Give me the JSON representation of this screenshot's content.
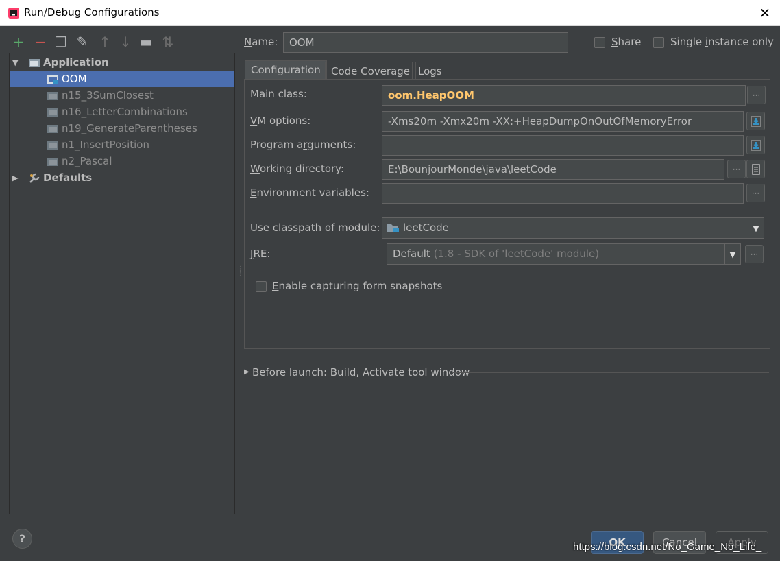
{
  "window": {
    "title": "Run/Debug Configurations"
  },
  "toolbar": [
    {
      "name": "add-icon",
      "glyph": "+",
      "color": "#59a869"
    },
    {
      "name": "remove-icon",
      "glyph": "−",
      "color": "#c75450"
    },
    {
      "name": "copy-icon",
      "glyph": "❐",
      "color": "#afb1b3"
    },
    {
      "name": "wrench-icon",
      "glyph": "✎",
      "color": "#afb1b3"
    },
    {
      "name": "arrow-up-icon",
      "glyph": "↑",
      "color": "#6e6e6e"
    },
    {
      "name": "arrow-down-icon",
      "glyph": "↓",
      "color": "#6e6e6e"
    },
    {
      "name": "folder-icon",
      "glyph": "▬",
      "color": "#afb1b3"
    },
    {
      "name": "sort-icon",
      "glyph": "⇅",
      "color": "#6e6e6e"
    }
  ],
  "tree": {
    "application": "Application",
    "items": [
      "OOM",
      "n15_3SumClosest",
      "n16_LetterCombinations",
      "n19_GenerateParentheses",
      "n1_InsertPosition",
      "n2_Pascal"
    ],
    "defaults": "Defaults"
  },
  "name": {
    "label_u": "N",
    "label_rest": "ame:",
    "value": "OOM"
  },
  "share": {
    "label_u": "S",
    "label_rest": "hare"
  },
  "single": {
    "label_pre": "Single ",
    "label_u": "i",
    "label_rest": "nstance only"
  },
  "tabs": [
    "Configuration",
    "Code Coverage",
    "Logs"
  ],
  "form": {
    "main_class_label": "Main class:",
    "main_class_value": "oom.HeapOOM",
    "vm_label_u": "V",
    "vm_label_rest": "M options:",
    "vm_value": "-Xms20m -Xmx20m -XX:+HeapDumpOnOutOfMemoryError",
    "prog_label_pre": "Program a",
    "prog_label_u": "r",
    "prog_label_rest": "guments:",
    "prog_value": "",
    "wd_label_u": "W",
    "wd_label_rest": "orking directory:",
    "wd_value": "E:\\BounjourMonde\\java\\leetCode",
    "env_label_u": "E",
    "env_label_rest": "nvironment variables:",
    "env_value": "",
    "cp_label_pre": "Use classpath of mo",
    "cp_label_u": "d",
    "cp_label_rest": "ule:",
    "cp_value": "leetCode",
    "jre_label_u": "J",
    "jre_label_rest": "RE:",
    "jre_value": "Default",
    "jre_detail": "(1.8 - SDK of 'leetCode' module)",
    "snap_label_u": "E",
    "snap_label_rest": "nable capturing form snapshots"
  },
  "before_launch": {
    "label_u": "B",
    "label_rest": "efore launch: Build, Activate tool window"
  },
  "buttons": {
    "ok": "OK",
    "cancel": "Cancel",
    "apply": "Apply"
  },
  "help": "?",
  "watermark": "https://blog.csdn.net/No_Game_No_Life_",
  "colors": {
    "accent": "#4b6eaf",
    "main_class": "#ffc66d",
    "ok_bg": "#365880"
  }
}
